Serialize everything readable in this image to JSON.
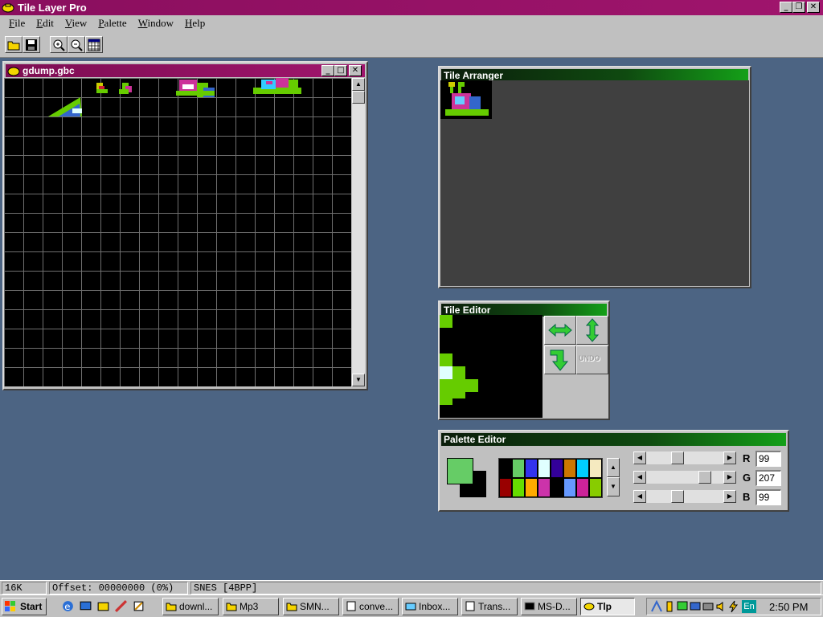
{
  "app": {
    "title": "Tile Layer Pro"
  },
  "menu": [
    "File",
    "Edit",
    "View",
    "Palette",
    "Window",
    "Help"
  ],
  "toolbar": {
    "icons": [
      "open-folder-icon",
      "save-disk-icon",
      "zoom-in-icon",
      "zoom-out-icon",
      "grid-icon"
    ]
  },
  "gdump": {
    "title": "gdump.gbc"
  },
  "arranger": {
    "title": "Tile Arranger"
  },
  "tile_editor": {
    "title": "Tile Editor",
    "undo_label": "UNDO"
  },
  "palette_editor": {
    "title": "Palette Editor",
    "current_color": "#66cc66",
    "swatches_top": [
      "#000000",
      "#66cc66",
      "#3333ee",
      "#e0ffff",
      "#330099",
      "#cc7700",
      "#00ccff",
      "#f5eac0"
    ],
    "swatches_bottom": [
      "#990000",
      "#66dd00",
      "#ffaa00",
      "#cc33aa",
      "#000000",
      "#6699ff",
      "#cc2299",
      "#88cc00"
    ],
    "r_label": "R",
    "g_label": "G",
    "b_label": "B",
    "r": "99",
    "g": "207",
    "b": "99"
  },
  "status": {
    "size": "16K",
    "offset": "Offset: 00000000 (0%)",
    "format": "SNES [4BPP]"
  },
  "taskbar": {
    "start": "Start",
    "tasks": [
      "downl...",
      "Mp3",
      "SMN...",
      "conve...",
      "Inbox...",
      "Trans...",
      "MS-D...",
      "Tlp"
    ],
    "clock": "2:50 PM",
    "lang": "En"
  }
}
